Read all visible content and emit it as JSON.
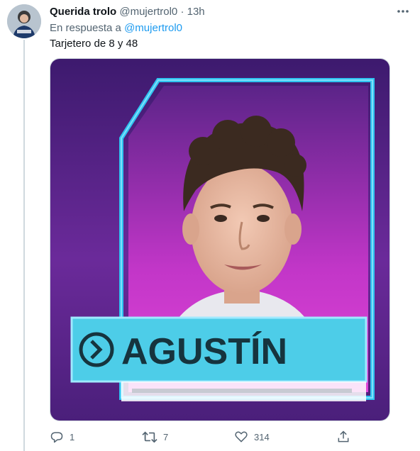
{
  "tweet": {
    "author_name": "Querida trolo",
    "author_handle": "@mujertrol0",
    "separator": "·",
    "time": "13h",
    "reply_prefix": "En respuesta a",
    "reply_handle": "@mujertrol0",
    "text": "Tarjetero de 8 y 48",
    "more_icon": "more-icon"
  },
  "media": {
    "card_name": "AGUSTÍN",
    "colors": {
      "frame": "#2fc3f0",
      "background": "#5a2a8a",
      "glow": "#d63bd8",
      "banner": "#4dcde8"
    }
  },
  "actions": {
    "reply_count": "1",
    "retweet_count": "7",
    "like_count": "314",
    "share_icon": "share-icon"
  }
}
